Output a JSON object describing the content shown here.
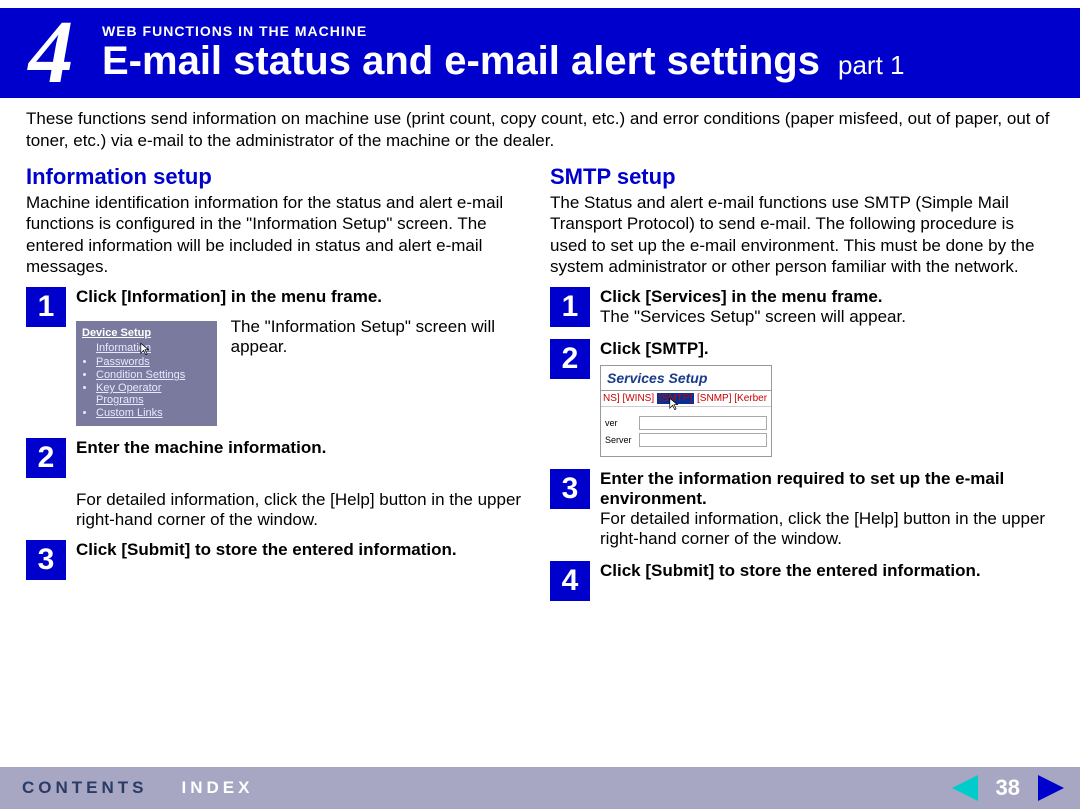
{
  "header": {
    "section_number": "4",
    "chapter": "WEB FUNCTIONS IN THE MACHINE",
    "title": "E-mail status and e-mail alert settings",
    "part": "part 1"
  },
  "intro": "These functions send information on machine use (print count, copy count, etc.) and error conditions (paper misfeed, out of paper, out of toner, etc.) via e-mail to the administrator of the machine or the dealer.",
  "left": {
    "heading": "Information setup",
    "lead": "Machine identification information for the status and alert e-mail functions is configured in the \"Information Setup\" screen. The entered information will be included in status and alert e-mail messages.",
    "step1_title": "Click [Information] in the menu frame.",
    "step1_note": "The \"Information Setup\" screen will appear.",
    "device_setup": {
      "title": "Device Setup",
      "items": [
        "Information",
        "Passwords",
        "Condition Settings",
        "Key Operator Programs",
        "Custom Links"
      ]
    },
    "step2_title": "Enter the machine information.",
    "step2_note": "For detailed information, click the [Help] button in the upper right-hand corner of the window.",
    "step3_title": "Click [Submit] to store the entered information."
  },
  "right": {
    "heading": "SMTP setup",
    "lead": "The Status and alert e-mail functions use SMTP (Simple Mail Transport Protocol) to send e-mail. The following procedure is used to set up the e-mail environment. This must be done by the system administrator or other person familiar with the network.",
    "step1_title": "Click [Services] in the menu frame.",
    "step1_note": "The \"Services Setup\" screen will appear.",
    "step2_title": "Click [SMTP].",
    "services_setup": {
      "title": "Services Setup",
      "tabs_left": "NS] [WINS] ",
      "tab_selected": "[SMTP]",
      "tabs_right": " [SNMP] [Kerber",
      "row1": "ver",
      "row2": "Server"
    },
    "step3_title": "Enter the information required to set up the e-mail environment.",
    "step3_note": "For detailed information, click the [Help] button in the upper right-hand corner of the window.",
    "step4_title": "Click [Submit] to store the entered information."
  },
  "footer": {
    "contents": "CONTENTS",
    "index": "INDEX",
    "page": "38"
  }
}
